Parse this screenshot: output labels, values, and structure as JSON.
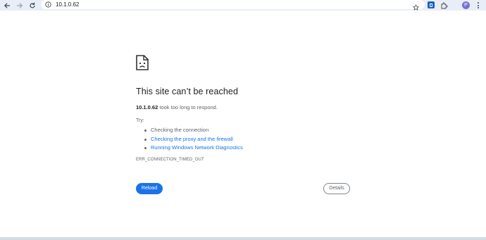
{
  "browser": {
    "url": "10.1.0.62",
    "back_icon": "arrow-left-icon",
    "forward_icon": "arrow-right-icon",
    "reload_icon": "reload-icon",
    "site_info_icon": "info-circle-icon",
    "bookmark_icon": "star-icon",
    "extension_icon": "password-manager-icon",
    "extensions_menu_icon": "puzzle-icon",
    "profile_initial": "P",
    "profile_color": "#7c6fd3",
    "menu_icon": "kebab-menu-icon"
  },
  "error": {
    "icon": "sad-page-icon",
    "title": "This site can’t be reached",
    "host": "10.1.0.62",
    "summary_rest": " took too long to respond.",
    "try_label": "Try:",
    "suggestions": [
      {
        "text": "Checking the connection",
        "is_link": false
      },
      {
        "text": "Checking the proxy and the firewall",
        "is_link": true
      },
      {
        "text": "Running Windows Network Diagnostics",
        "is_link": true
      }
    ],
    "error_code": "ERR_CONNECTION_TIMED_OUT",
    "reload_label": "Reload",
    "details_label": "Details"
  },
  "colors": {
    "accent": "#1a73e8",
    "toolbar_bg": "#e8eef7",
    "text": "#202124",
    "secondary_text": "#5f6368"
  }
}
